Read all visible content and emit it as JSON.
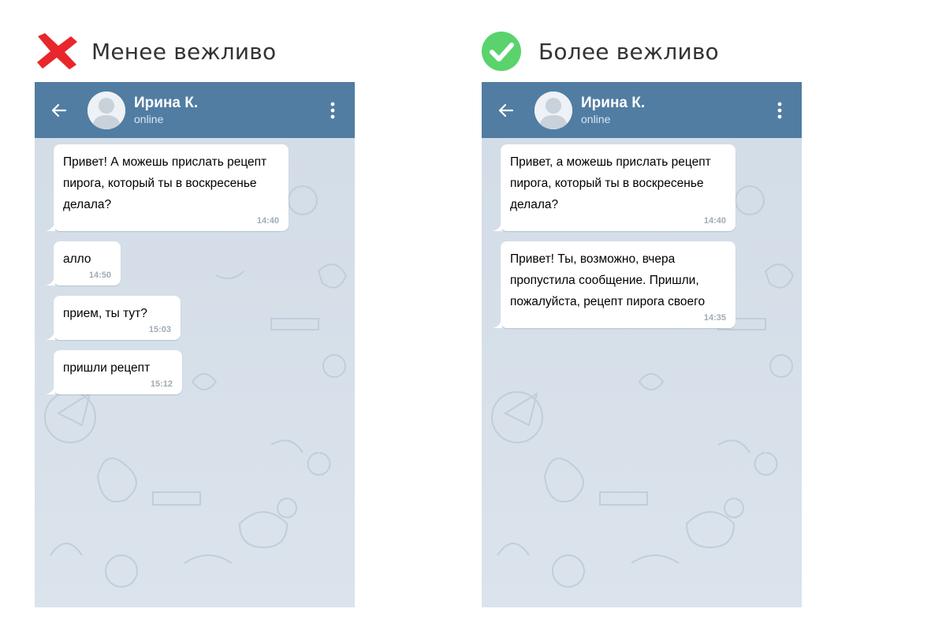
{
  "comparison": {
    "left": {
      "caption": "Менее вежливо",
      "icon": "red-cross-icon",
      "color": "#e8262b"
    },
    "right": {
      "caption": "Более вежливо",
      "icon": "green-check-icon",
      "color": "#5ad36d"
    }
  },
  "chat": {
    "contact_name": "Ирина К.",
    "contact_status": "online",
    "header_color": "#517da2",
    "background_color": "#cfd9e4"
  },
  "left_messages": [
    {
      "text": "Привет! А можешь прислать рецепт\nпирога, который ты в воскресенье\nделала?",
      "time": "14:40"
    },
    {
      "text": "алло",
      "time": "14:50"
    },
    {
      "text": "прием, ты тут?",
      "time": "15:03"
    },
    {
      "text": "пришли рецепт",
      "time": "15:12"
    }
  ],
  "right_messages": [
    {
      "text": "Привет, а можешь прислать рецепт\nпирога, который ты в воскресенье\nделала?",
      "time": "14:40"
    },
    {
      "text": "Привет! Ты, возможно, вчера\nпропустила сообщение. Пришли,\nпожалуйста, рецепт пирога своего",
      "time": "14:35"
    }
  ]
}
